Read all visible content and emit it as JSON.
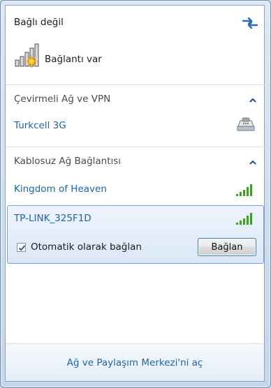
{
  "header": {
    "status_title": "Bağlı değil"
  },
  "connection": {
    "status_text": "Bağlantı var"
  },
  "sections": [
    {
      "title": "Çevirmeli Ağ ve VPN",
      "items": [
        {
          "name": "Turkcell 3G",
          "icon": "modem-icon"
        }
      ]
    },
    {
      "title": "Kablosuz Ağ Bağlantısı",
      "items": [
        {
          "name": "Kingdom of Heaven",
          "icon": "signal-strength-icon"
        },
        {
          "name": "TP-LINK_325F1D",
          "icon": "signal-strength-icon",
          "selected": true
        }
      ]
    }
  ],
  "selected_network": {
    "auto_connect_label": "Otomatik olarak bağlan",
    "auto_connect_checked": true,
    "connect_button_label": "Bağlan"
  },
  "footer": {
    "link_text": "Ağ ve Paylaşım Merkezi'ni aç"
  },
  "colors": {
    "link": "#1c63b0",
    "signal": "#3aa31c",
    "selection_border": "#7da2ce"
  }
}
